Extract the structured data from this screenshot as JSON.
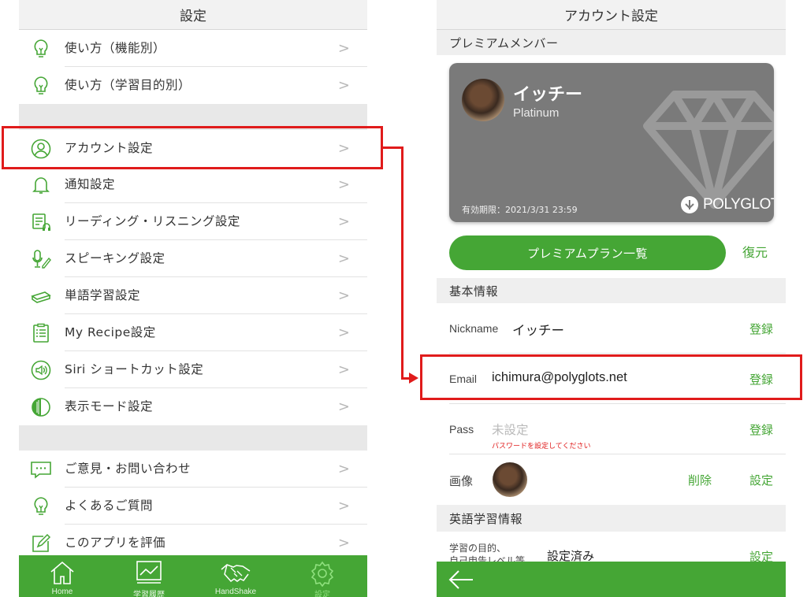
{
  "left": {
    "title": "設定",
    "group1": [
      {
        "label": "使い方（機能別）",
        "icon": "lightbulb-icon"
      },
      {
        "label": "使い方（学習目的別）",
        "icon": "lightbulb-icon"
      }
    ],
    "group2": [
      {
        "label": "アカウント設定",
        "icon": "user-icon"
      },
      {
        "label": "通知設定",
        "icon": "bell-icon"
      },
      {
        "label": "リーディング・リスニング設定",
        "icon": "reading-listening-icon"
      },
      {
        "label": "スピーキング設定",
        "icon": "microphone-icon"
      },
      {
        "label": "単語学習設定",
        "icon": "word-cards-icon"
      },
      {
        "label": "My Recipe設定",
        "icon": "clipboard-icon"
      },
      {
        "label": "Siri ショートカット設定",
        "icon": "speaker-icon"
      },
      {
        "label": "表示モード設定",
        "icon": "display-mode-icon"
      }
    ],
    "group3": [
      {
        "label": "ご意見・お問い合わせ",
        "icon": "chat-bubble-icon"
      },
      {
        "label": "よくあるご質問",
        "icon": "lightbulb-icon"
      },
      {
        "label": "このアプリを評価",
        "icon": "edit-icon"
      }
    ],
    "chevron": ">",
    "tabs": [
      {
        "label": "Home",
        "icon": "home-icon"
      },
      {
        "label": "学習履歴",
        "icon": "chart-icon"
      },
      {
        "label": "HandShake",
        "icon": "handshake-icon"
      },
      {
        "label": "設定",
        "icon": "gear-icon",
        "active": true
      }
    ]
  },
  "right": {
    "title": "アカウント設定",
    "premium_section": "プレミアムメンバー",
    "card": {
      "name": "イッチー",
      "plan": "Platinum",
      "expiry": "有効期限：2021/3/31 23:59",
      "brand": "POLYGLOTS"
    },
    "plan_button": "プレミアムプラン一覧",
    "restore_button": "復元",
    "basic_section": "基本情報",
    "nickname": {
      "label": "Nickname",
      "value": "イッチー",
      "action": "登録"
    },
    "email": {
      "label": "Email",
      "value": "ichimura@polyglots.net",
      "action": "登録"
    },
    "pass": {
      "label": "Pass",
      "value": "未設定",
      "hint": "パスワードを設定してください",
      "action": "登録"
    },
    "image": {
      "label": "画像",
      "delete": "削除",
      "action": "設定"
    },
    "english_section": "英語学習情報",
    "learning": {
      "label": "学習の目的、",
      "label2": "自己申告レベル等",
      "value": "設定済み",
      "action": "設定"
    }
  },
  "colors": {
    "accent": "#45a635",
    "highlight": "#e01b1b",
    "card": "#7a7a7a"
  }
}
